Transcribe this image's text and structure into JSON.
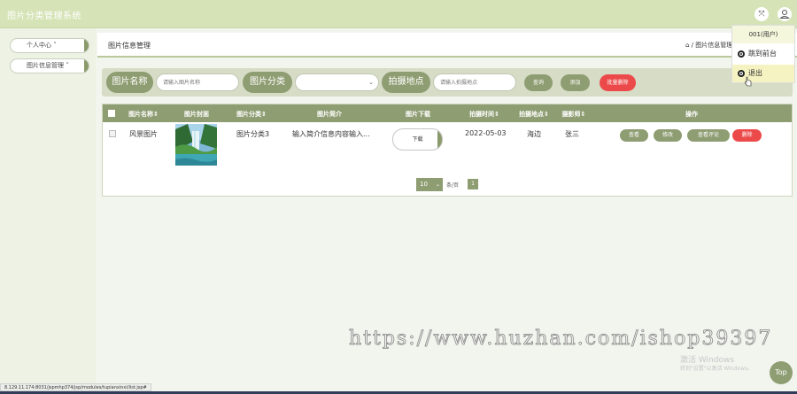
{
  "app": {
    "title": "图片分类管理系统"
  },
  "topbar": {
    "fullscreen_icon": "fullscreen-icon",
    "user_icon": "user-icon"
  },
  "sidebar": {
    "items": [
      {
        "label": "个人中心 ˅"
      },
      {
        "label": "图片信息管理 ˅"
      }
    ]
  },
  "header": {
    "title": "图片信息管理",
    "breadcrumb": "⌂ / 图片信息管理"
  },
  "user_menu": {
    "user": "001(用户)",
    "items": [
      {
        "label": "跳到前台"
      },
      {
        "label": "退出"
      }
    ]
  },
  "search": {
    "name_label": "图片名称",
    "name_placeholder": "请输入图片名称",
    "category_label": "图片分类",
    "category_value": "",
    "location_label": "拍摄地点",
    "location_placeholder": "请输入拍摄地点",
    "query_btn": "查询",
    "add_btn": "添加",
    "batch_delete_btn": "批量删除"
  },
  "table": {
    "columns": [
      "图片名称⇕",
      "图片封面",
      "图片分类⇕",
      "图片简介",
      "图片下载",
      "拍摄时间⇕",
      "拍摄地点⇕",
      "摄影师⇕",
      "操作"
    ],
    "rows": [
      {
        "name": "风景图片",
        "category": "图片分类3",
        "intro": "输入简介信息内容输入...",
        "download": "下载",
        "date": "2022-05-03",
        "location": "海边",
        "photographer": "张三",
        "actions": [
          "查看",
          "修改",
          "查看评论",
          "删除"
        ]
      }
    ]
  },
  "pagination": {
    "page_size": "10",
    "per_page_label": "条/页",
    "current_page": "1"
  },
  "watermark": "https://www.huzhan.com/ishop39397",
  "windows_activation": {
    "line1": "激活 Windows",
    "line2": "转到\"设置\"以激活 Windows。"
  },
  "top_button": "Top",
  "status_url": "8.129.11.174:8031/jspmhp374/jsp/modules/tupianxinxi/list.jsp#",
  "colors": {
    "accent": "#8f9d72",
    "topbar": "#d5e3b6",
    "danger": "#ec4a4a"
  }
}
